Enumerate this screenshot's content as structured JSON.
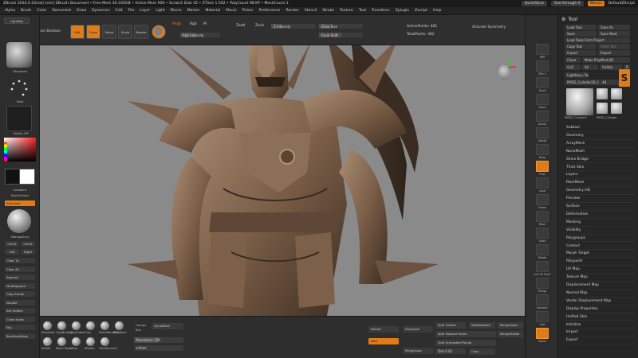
{
  "titlebar": {
    "title": "ZBrush 2024.0.2(trial) [slm]   ZBrush Document    • Free Mem 40.165GB • Active Mem 900 • Scratch Disk 45 • ZTime 1.562 • PolyCount 98 KP • MeshCount 1",
    "quicksave": "QuickSave",
    "seethrough": "See-through  0",
    "menus": "Menus",
    "script": "DefaultZScript"
  },
  "menubar": [
    "Alpha",
    "Brush",
    "Color",
    "Document",
    "Draw",
    "Dynamics",
    "Edit",
    "File",
    "Layer",
    "Light",
    "Macro",
    "Marker",
    "Material",
    "Movie",
    "Picker",
    "Preferences",
    "Render",
    "Stencil",
    "Stroke",
    "Texture",
    "Tool",
    "Transform",
    "Zplugin",
    "Zscript",
    "Help"
  ],
  "topshelf": {
    "lightbox": "LightBox",
    "livebool": "Live Boolean",
    "edit": "Edit",
    "draw": "Draw",
    "move": "Move",
    "scale": "Scale",
    "rotate": "Rotate",
    "mrgb": "Mrgb",
    "rgb": "Rgb",
    "m": "M",
    "zadd": "Zadd",
    "zsub": "Zsub",
    "rgb_intensity": "Rgb Intensity",
    "z_intensity": "Z Intensity",
    "draw_size": "Draw Size",
    "focal_shift": "Focal Shift",
    "active_points_label": "ActivePoints:",
    "active_points": "482",
    "total_points_label": "TotalPoints:",
    "total_points": "482",
    "activate_symmetry": "Activate Symmetry"
  },
  "lefttray": {
    "brush_caption": "Standard",
    "stroke_caption": "Dots",
    "alpha_caption": "~Alpha Off",
    "gradient": "Gradient",
    "switch_color": "SwitchColor",
    "alternate": "Alternate",
    "material_caption": "MatcapGray",
    "buttons": [
      "Clear Tp",
      "Clear All",
      "Append",
      "MultiAppend",
      "Copy Folder",
      "Double",
      "Set Hidden",
      "Close Holes",
      "Flip",
      "BackfaceMask"
    ],
    "halfs": [
      "Conf1",
      "Conf2",
      "Left",
      "Right"
    ]
  },
  "bottomshelf": {
    "brushes": [
      "Standard",
      "ClayBuildup",
      "ClayTubes",
      "Clay",
      "DamStandard",
      "ZModeler",
      "Inflate",
      "Move Topo",
      "Move",
      "hPolish",
      "TrimDynamic"
    ],
    "groups": "Groups",
    "dynamesh": "DynaMesh",
    "resolution_label": "Resolution",
    "resolution": "128",
    "blur": "Blur",
    "blur_val": "2",
    "inflate": "Inflate",
    "delete": "Delete",
    "duplicate": "Duplicate",
    "new": "New",
    "polygroups": "Polygroups",
    "split_hidden": "Split Hidden",
    "split_masked": "Split Masked Points",
    "split_unmasked": "Split Unmasked Points",
    "weld_masked": "WeldMasked",
    "merge_down": "MergeDown",
    "mergevisible": "MergeVisible",
    "dist_label": "Dist",
    "dist": "0.02",
    "copy": "Copy"
  },
  "righttray": [
    "BPR",
    "SPix 3",
    "Scroll",
    "Zoom",
    "Actual",
    "AAHalf",
    "Persp",
    "Floor",
    "Local",
    "Frame",
    "Move",
    "Scale",
    "Rotate",
    "Line Fill PolyF",
    "Transp",
    "Dynamic",
    "Solo",
    "Xpose"
  ],
  "toolpanel": {
    "title": "Tool",
    "load_tool": "Load Tool",
    "save_as": "Save As",
    "save": "Save",
    "save_next": "Save Next",
    "load_from_project": "Load Tools From Project",
    "copy_tool": "Copy Tool",
    "paste_tool": "Paste Tool",
    "import": "Import",
    "export": "Export",
    "clone": "Clone",
    "make_polymesh": "Make PolyMesh3D",
    "goz": "GoZ",
    "all": "All",
    "visible": "Visible",
    "r": "R",
    "lightbox_tools": "Lightbox ▸ Tools",
    "current_tool": "PM3D_Cylinder3D_1 . 48",
    "thumb_caption": "PM3D_Cylinder3",
    "thumb_caption2": "PM3D_Cylinder",
    "list": [
      "Subtool",
      "Geometry",
      "ArrayMesh",
      "NanoMesh",
      "Shine Bridge",
      "Thick Skin",
      "Layers",
      "FiberMesh",
      "Geometry HD",
      "Preview",
      "Surface",
      "Deformation",
      "Masking",
      "Visibility",
      "Polygroups",
      "Contact",
      "Morph Target",
      "Polypaint",
      "UV Map",
      "Texture Map",
      "Displacement Map",
      "Normal Map",
      "Vector Displacement Map",
      "Display Properties",
      "Unified Skin",
      "Initialize",
      "Import",
      "Export"
    ]
  },
  "colors": {
    "accent": "#e07b1a",
    "canvas": "#8a8a8a",
    "model": "#7b5f48"
  }
}
